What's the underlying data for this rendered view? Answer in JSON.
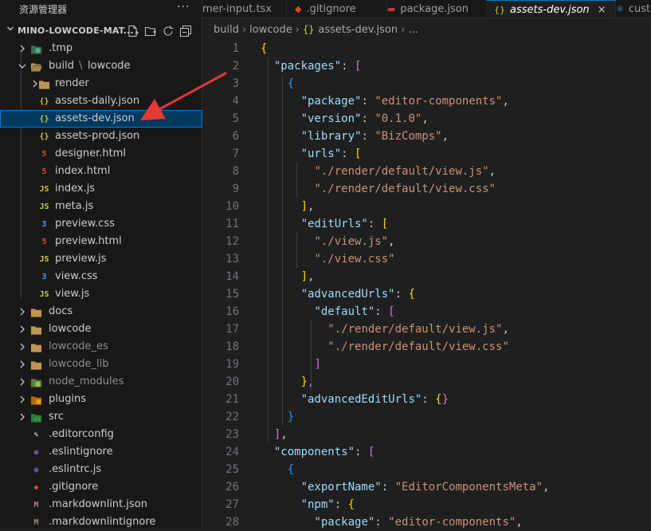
{
  "sidebar": {
    "title": "资源管理器",
    "root_label": "MINO-LOWCODE-MAT...",
    "tree": [
      {
        "label": ".tmp",
        "depth": 1,
        "chevron": "right",
        "icon": "tmp-folder-icon",
        "icon_color": "#4caf92"
      },
      {
        "label": "build",
        "label2": "lowcode",
        "depth": 1,
        "chevron": "down",
        "icon": "folder-open-icon",
        "icon_color": "#c09553"
      },
      {
        "label": "render",
        "depth": 2,
        "chevron": "right",
        "icon": "folder-icon",
        "icon_color": "#c09553"
      },
      {
        "label": "assets-daily.json",
        "depth": 2,
        "icon": "json-icon",
        "icon_glyph": "{}",
        "icon_color": "#cbcb41"
      },
      {
        "label": "assets-dev.json",
        "depth": 2,
        "icon": "json-icon",
        "icon_glyph": "{}",
        "icon_color": "#cbcb41",
        "selected": true
      },
      {
        "label": "assets-prod.json",
        "depth": 2,
        "icon": "json-icon",
        "icon_glyph": "{}",
        "icon_color": "#cbcb41"
      },
      {
        "label": "designer.html",
        "depth": 2,
        "icon": "html-icon",
        "icon_glyph": "5",
        "icon_color": "#e44d26"
      },
      {
        "label": "index.html",
        "depth": 2,
        "icon": "html-icon",
        "icon_glyph": "5",
        "icon_color": "#e44d26"
      },
      {
        "label": "index.js",
        "depth": 2,
        "icon": "js-icon",
        "icon_glyph": "JS",
        "icon_color": "#cbcb41"
      },
      {
        "label": "meta.js",
        "depth": 2,
        "icon": "js-icon",
        "icon_glyph": "JS",
        "icon_color": "#cbcb41"
      },
      {
        "label": "preview.css",
        "depth": 2,
        "icon": "css-icon",
        "icon_glyph": "3",
        "icon_color": "#42a5f5"
      },
      {
        "label": "preview.html",
        "depth": 2,
        "icon": "html-icon",
        "icon_glyph": "5",
        "icon_color": "#e44d26"
      },
      {
        "label": "preview.js",
        "depth": 2,
        "icon": "js-icon",
        "icon_glyph": "JS",
        "icon_color": "#cbcb41"
      },
      {
        "label": "view.css",
        "depth": 2,
        "icon": "css-icon",
        "icon_glyph": "3",
        "icon_color": "#42a5f5"
      },
      {
        "label": "view.js",
        "depth": 2,
        "icon": "js-icon",
        "icon_glyph": "JS",
        "icon_color": "#cbcb41"
      },
      {
        "label": "docs",
        "depth": 1,
        "chevron": "right",
        "icon": "folder-icon",
        "icon_color": "#c09553"
      },
      {
        "label": "lowcode",
        "depth": 1,
        "chevron": "right",
        "icon": "folder-icon",
        "icon_color": "#c09553"
      },
      {
        "label": "lowcode_es",
        "depth": 1,
        "chevron": "right",
        "icon": "folder-icon",
        "icon_color": "#c09553",
        "dim": true
      },
      {
        "label": "lowcode_lib",
        "depth": 1,
        "chevron": "right",
        "icon": "folder-icon",
        "icon_color": "#c09553",
        "dim": true
      },
      {
        "label": "node_modules",
        "depth": 1,
        "chevron": "right",
        "icon": "node-folder-icon",
        "icon_color": "#8bc34a",
        "dim": true
      },
      {
        "label": "plugins",
        "depth": 1,
        "chevron": "right",
        "icon": "plugins-folder-icon",
        "icon_color": "#ff9800"
      },
      {
        "label": "src",
        "depth": 1,
        "chevron": "right",
        "icon": "src-folder-icon",
        "icon_color": "#4caf50"
      },
      {
        "label": ".editorconfig",
        "depth": 1,
        "icon": "editorconfig-icon",
        "icon_glyph": "✎",
        "icon_color": "#e0e0e0"
      },
      {
        "label": ".eslintignore",
        "depth": 1,
        "icon": "eslint-icon",
        "icon_glyph": "◉",
        "icon_color": "#7e57c2"
      },
      {
        "label": ".eslintrc.js",
        "depth": 1,
        "icon": "eslint-icon",
        "icon_glyph": "◉",
        "icon_color": "#7e57c2"
      },
      {
        "label": ".gitignore",
        "depth": 1,
        "icon": "git-icon",
        "icon_glyph": "◆",
        "icon_color": "#e64a19"
      },
      {
        "label": ".markdownlint.json",
        "depth": 1,
        "icon": "markdownlint-icon",
        "icon_glyph": "M",
        "icon_color": "#a1887f"
      },
      {
        "label": ".markdownlintignore",
        "depth": 1,
        "icon": "markdownlint-icon",
        "icon_glyph": "M",
        "icon_color": "#a1887f"
      }
    ]
  },
  "tabs": [
    {
      "label": "mer-input.tsx",
      "icon": "tsx-icon",
      "icon_glyph": "",
      "icon_color": "#42a5f5"
    },
    {
      "label": ".gitignore",
      "icon": "git-icon",
      "icon_glyph": "◆",
      "icon_color": "#e64a19"
    },
    {
      "label": "package.json",
      "icon": "npm-icon",
      "icon_glyph": "▬",
      "icon_color": "#cb3837"
    },
    {
      "label": "assets-dev.json",
      "icon": "json-icon",
      "icon_glyph": "{}",
      "icon_color": "#cbcb41",
      "active": true,
      "close": "×"
    },
    {
      "label": "custo",
      "icon": "react-icon",
      "icon_glyph": "⚛",
      "icon_color": "#42a5f5"
    }
  ],
  "breadcrumb": {
    "items": [
      "build",
      "lowcode",
      "assets-dev.json",
      "..."
    ],
    "file_icon_glyph": "{}",
    "separator": "›"
  },
  "code_lines": [
    "{",
    "  \"packages\": [",
    "    {",
    "      \"package\": \"editor-components\",",
    "      \"version\": \"0.1.0\",",
    "      \"library\": \"BizComps\",",
    "      \"urls\": [",
    "        \"./render/default/view.js\",",
    "        \"./render/default/view.css\"",
    "      ],",
    "      \"editUrls\": [",
    "        \"./view.js\",",
    "        \"./view.css\"",
    "      ],",
    "      \"advancedUrls\": {",
    "        \"default\": [",
    "          \"./render/default/view.js\",",
    "          \"./render/default/view.css\"",
    "        ]",
    "      },",
    "      \"advancedEditUrls\": {}",
    "    }",
    "  ],",
    "  \"components\": [",
    "    {",
    "      \"exportName\": \"EditorComponentsMeta\",",
    "      \"npm\": {",
    "        \"package\": \"editor-components\","
  ],
  "colors": {
    "key": "#9cdcfe",
    "string": "#ce9178",
    "bracket_level1": "#ffd700",
    "bracket_level2": "#da70d6",
    "bracket_level3": "#179fff",
    "annotation_arrow": "#e53935",
    "selection": "#04395e"
  }
}
